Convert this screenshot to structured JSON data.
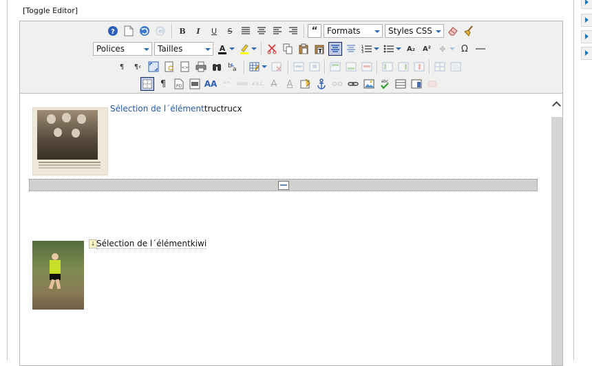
{
  "page": {
    "toggle_label": "[Toggle Editor]"
  },
  "toolbar": {
    "formats_label": "Formats",
    "styles_label": "Styles CSS",
    "fonts_label": "Polices",
    "sizes_label": "Tailles",
    "bold": "B",
    "italic": "I",
    "underline": "U",
    "strike": "S",
    "blockquote": "“",
    "pilcrow_ltr": "¶",
    "pilcrow_rtl": "¶‹",
    "visual_chars": "¶",
    "abbr": "ABBR",
    "acronym": "A.B.C.",
    "cite": "“”",
    "omega": "Ω",
    "subscript": "A₂",
    "superscript": "A²",
    "style_text": "AA",
    "del": "A",
    "ins": "A"
  },
  "content": {
    "block1_highlight": "Sélection de l´élément",
    "block1_text": "tructrucx",
    "block2_text": "Sélection de l´élémentkiwi"
  },
  "colors": {
    "accent": "#2459a8",
    "toolbar_bg": "#f0f0ee",
    "font_color_bar": "#000000",
    "highlight_bar": "#ffff00"
  }
}
